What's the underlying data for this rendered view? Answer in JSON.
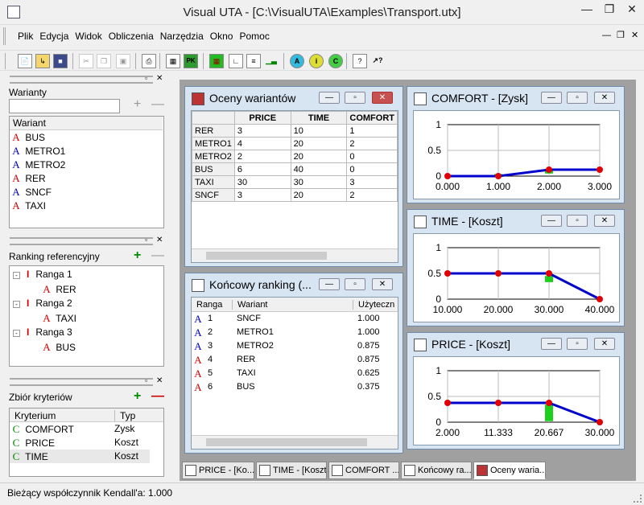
{
  "window": {
    "title": "Visual UTA - [C:\\VisualUTA\\Examples\\Transport.utx]"
  },
  "menu": [
    "Plik",
    "Edycja",
    "Widok",
    "Obliczenia",
    "Narzędzia",
    "Okno",
    "Pomoc"
  ],
  "left": {
    "variants_label": "Warianty",
    "variants_header": "Wariant",
    "variants": [
      {
        "letter": "A",
        "color": "red",
        "name": "BUS"
      },
      {
        "letter": "A",
        "color": "blue",
        "name": "METRO1"
      },
      {
        "letter": "A",
        "color": "blue",
        "name": "METRO2"
      },
      {
        "letter": "A",
        "color": "red",
        "name": "RER"
      },
      {
        "letter": "A",
        "color": "blue",
        "name": "SNCF"
      },
      {
        "letter": "A",
        "color": "red",
        "name": "TAXI"
      }
    ],
    "ranking_label": "Ranking referencyjny",
    "ranks": [
      {
        "name": "Ranga 1",
        "item": "RER"
      },
      {
        "name": "Ranga 2",
        "item": "TAXI"
      },
      {
        "name": "Ranga 3",
        "item": "BUS"
      }
    ],
    "criteria_label": "Zbiór kryteriów",
    "criteria_headers": [
      "Kryterium",
      "Typ"
    ],
    "criteria": [
      {
        "name": "COMFORT",
        "type": "Zysk"
      },
      {
        "name": "PRICE",
        "type": "Koszt"
      },
      {
        "name": "TIME",
        "type": "Koszt"
      }
    ]
  },
  "evaluations": {
    "title": "Oceny wariantów",
    "headers": [
      "",
      "PRICE",
      "TIME",
      "COMFORT"
    ],
    "rows": [
      [
        "RER",
        "3",
        "10",
        "1"
      ],
      [
        "METRO1",
        "4",
        "20",
        "2"
      ],
      [
        "METRO2",
        "2",
        "20",
        "0"
      ],
      [
        "BUS",
        "6",
        "40",
        "0"
      ],
      [
        "TAXI",
        "30",
        "30",
        "3"
      ],
      [
        "SNCF",
        "3",
        "20",
        "2"
      ]
    ]
  },
  "final_ranking": {
    "title": "Końcowy ranking (...",
    "headers": [
      "Ranga",
      "Wariant",
      "Użyteczn"
    ],
    "rows": [
      {
        "color": "blue",
        "rank": "1",
        "variant": "SNCF",
        "utility": "1.000"
      },
      {
        "color": "blue",
        "rank": "2",
        "variant": "METRO1",
        "utility": "1.000"
      },
      {
        "color": "blue",
        "rank": "3",
        "variant": "METRO2",
        "utility": "0.875"
      },
      {
        "color": "red",
        "rank": "4",
        "variant": "RER",
        "utility": "0.875"
      },
      {
        "color": "red",
        "rank": "5",
        "variant": "TAXI",
        "utility": "0.625"
      },
      {
        "color": "red",
        "rank": "6",
        "variant": "BUS",
        "utility": "0.375"
      }
    ]
  },
  "chart_data": [
    {
      "type": "line",
      "title": "COMFORT - [Zysk]",
      "x": [
        0,
        1,
        2,
        3
      ],
      "tick_labels": [
        "0.000",
        "1.000",
        "2.000",
        "3.000"
      ],
      "values": [
        0,
        0,
        0.125,
        0.125
      ],
      "ylim": [
        0,
        1
      ],
      "yticks": [
        "1",
        "0.5",
        "0"
      ],
      "bars": [
        {
          "x": 1,
          "top": 0.04,
          "bottom": -0.02
        },
        {
          "x": 2,
          "top": 0.12,
          "bottom": 0.05
        }
      ]
    },
    {
      "type": "line",
      "title": "TIME - [Koszt]",
      "x": [
        10,
        20,
        30,
        40
      ],
      "tick_labels": [
        "10.000",
        "20.000",
        "30.000",
        "40.000"
      ],
      "values": [
        0.5,
        0.5,
        0.5,
        0
      ],
      "ylim": [
        0,
        1
      ],
      "yticks": [
        "1",
        "0.5",
        "0"
      ],
      "bars": [
        {
          "x": 30,
          "top": 0.45,
          "bottom": 0.33
        }
      ]
    },
    {
      "type": "line",
      "title": "PRICE - [Koszt]",
      "x": [
        2,
        11.333,
        20.667,
        30
      ],
      "tick_labels": [
        "2.000",
        "11.333",
        "20.667",
        "30.000"
      ],
      "values": [
        0.375,
        0.375,
        0.375,
        0
      ],
      "ylim": [
        0,
        1
      ],
      "yticks": [
        "1",
        "0.5",
        "0"
      ],
      "bars": [
        {
          "x": 20.667,
          "top": 0.34,
          "bottom": 0.02
        }
      ]
    }
  ],
  "tabs": [
    "PRICE - [Ko...",
    "TIME - [Koszt]",
    "COMFORT ...",
    "Końcowy ra...",
    "Oceny waria..."
  ],
  "status": "Bieżący współczynnik Kendall'a: 1.000"
}
